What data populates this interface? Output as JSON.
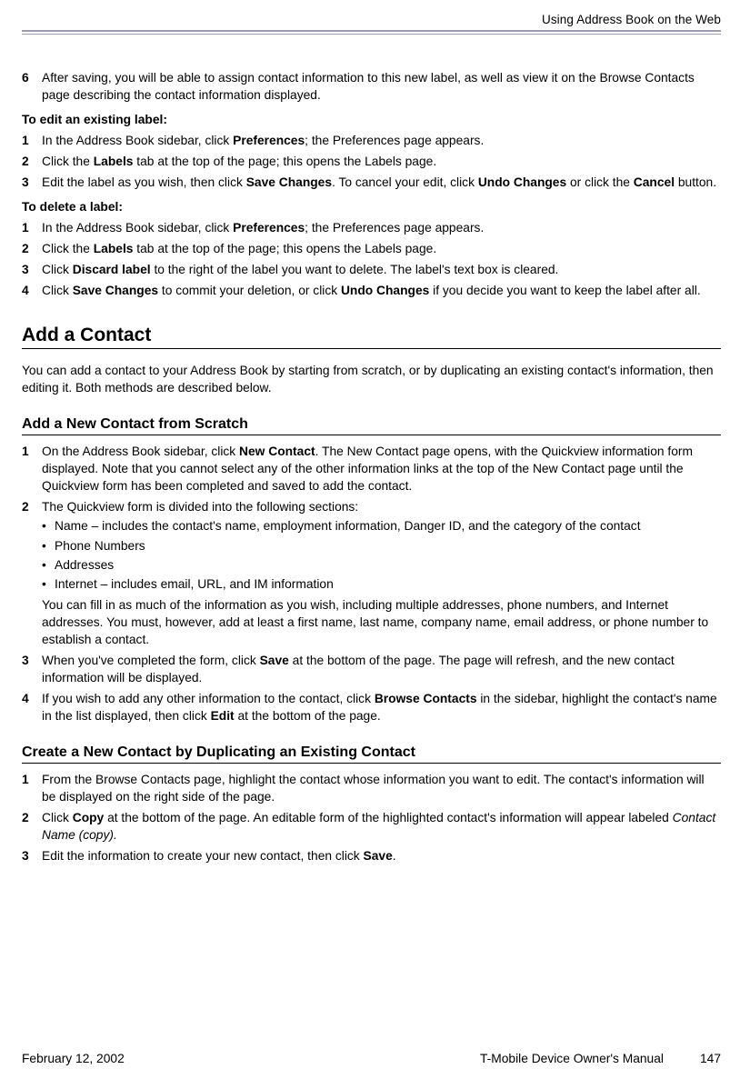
{
  "header": {
    "running_title": "Using Address Book on the Web"
  },
  "step6": {
    "num": "6",
    "text": "After saving, you will be able to assign contact information to this new label, as well as view it on the Browse Contacts page describing the contact information displayed."
  },
  "edit_heading": "To edit an existing label",
  "edit_steps": [
    {
      "num": "1",
      "pre": "In the Address Book sidebar, click ",
      "b1": "Preferences",
      "post": "; the Preferences page appears."
    },
    {
      "num": "2",
      "pre": "Click the ",
      "b1": "Labels",
      "post": " tab at the top of the page; this opens the Labels page."
    },
    {
      "num": "3",
      "pre": "Edit the label as you wish, then click ",
      "b1": "Save Changes",
      "mid": ". To cancel your edit, click ",
      "b2": "Undo Changes",
      "mid2": " or click the ",
      "b3": "Cancel",
      "post": " button."
    }
  ],
  "delete_heading": "To delete a label",
  "delete_steps": [
    {
      "num": "1",
      "pre": "In the Address Book sidebar, click ",
      "b1": "Preferences",
      "post": "; the Preferences page appears."
    },
    {
      "num": "2",
      "pre": "Click the ",
      "b1": "Labels",
      "post": " tab at the top of the page; this opens the Labels page."
    },
    {
      "num": "3",
      "pre": "Click ",
      "b1": "Discard label",
      "post": " to the right of the label you want to delete. The label's text box is cleared."
    },
    {
      "num": "4",
      "pre": "Click ",
      "b1": "Save Changes",
      "mid": " to commit your deletion, or click ",
      "b2": "Undo Changes",
      "post": " if you decide you want to keep the label after all."
    }
  ],
  "add_contact_h1": "Add a Contact",
  "add_contact_para": "You can add a contact to your Address Book by starting from scratch, or by duplicating an existing contact's information, then editing it. Both methods are described below.",
  "scratch_h2": "Add a New Contact from Scratch",
  "scratch_steps": {
    "s1": {
      "num": "1",
      "pre": "On the Address Book sidebar, click ",
      "b1": "New Contact",
      "post": ". The New Contact page opens, with the Quickview information form displayed. Note that you cannot select any of the other information links at the top of the New Contact page until the Quickview form has been completed and saved to add the contact."
    },
    "s2": {
      "num": "2",
      "text": "The Quickview form is divided into the following sections:"
    },
    "bullets": [
      "Name – includes the contact's name, employment information, Danger ID, and the category of the contact",
      "Phone Numbers",
      "Addresses",
      "Internet – includes email, URL, and IM information"
    ],
    "s2_after": "You can fill in as much of the information as you wish, including multiple addresses, phone numbers, and Internet addresses. You must, however, add at least a first name, last name, company name, email address, or phone number to establish a contact.",
    "s3": {
      "num": "3",
      "pre": "When you've completed the form, click ",
      "b1": "Save",
      "post": " at the bottom of the page. The page will refresh, and the new contact information will be displayed."
    },
    "s4": {
      "num": "4",
      "pre": "If you wish to add any other information to the contact, click ",
      "b1": "Browse Contacts",
      "mid": " in the sidebar, highlight the contact's name in the list displayed, then click ",
      "b2": "Edit",
      "post": " at the bottom of the page."
    }
  },
  "dup_h2": "Create a New Contact by Duplicating an Existing Contact",
  "dup_steps": {
    "s1": {
      "num": "1",
      "text": "From the Browse Contacts page, highlight the contact whose information you want to edit. The contact's information will be displayed on the right side of the page."
    },
    "s2": {
      "num": "2",
      "pre": "Click ",
      "b1": "Copy",
      "mid": " at the bottom of the page. An editable form of the highlighted contact's information will appear labeled ",
      "ital": "Contact Name (copy).",
      "post": ""
    },
    "s3": {
      "num": "3",
      "pre": "Edit the information to create your new contact, then click ",
      "b1": "Save",
      "post": "."
    }
  },
  "footer": {
    "date": "February 12, 2002",
    "manual": "T-Mobile Device Owner's Manual",
    "page": "147"
  },
  "colon": ":",
  "bullet_char": "•"
}
